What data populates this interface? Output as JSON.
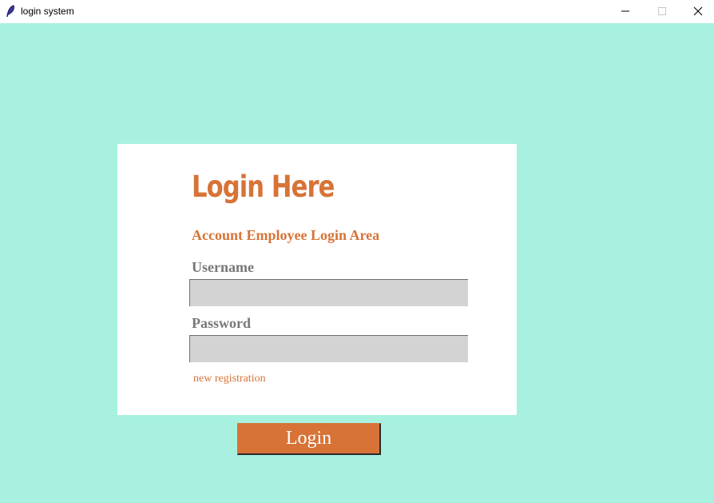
{
  "window": {
    "title": "login system"
  },
  "form": {
    "heading": "Login Here",
    "subheading": "Account Employee Login Area",
    "username_label": "Username",
    "username_value": "",
    "password_label": "Password",
    "password_value": "",
    "registration_link": "new registration",
    "login_button": "Login"
  },
  "colors": {
    "background": "#a8f1e1",
    "accent": "#d77337",
    "label": "#777777",
    "entry": "#d3d3d3"
  },
  "icons": {
    "app": "feather-icon",
    "minimize": "minimize-icon",
    "maximize": "maximize-icon",
    "close": "close-icon"
  }
}
